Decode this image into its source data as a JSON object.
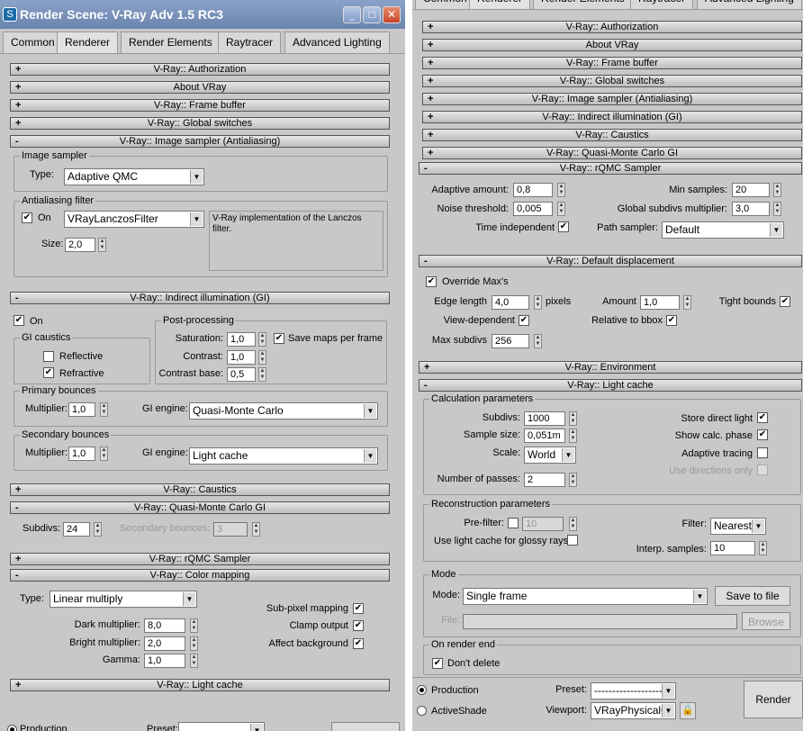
{
  "left": {
    "window_title": "Render Scene: V-Ray Adv 1.5 RC3",
    "tabs": [
      "Common",
      "Renderer",
      "Render Elements",
      "Raytracer",
      "Advanced Lighting"
    ],
    "rollouts": {
      "auth": "V-Ray:: Authorization",
      "about": "About VRay",
      "fb": "V-Ray:: Frame buffer",
      "gs": "V-Ray:: Global switches",
      "is": "V-Ray:: Image sampler (Antialiasing)",
      "gi": "V-Ray:: Indirect illumination (GI)",
      "caustics": "V-Ray:: Caustics",
      "qmc": "V-Ray:: Quasi-Monte Carlo GI",
      "rqmc": "V-Ray:: rQMC Sampler",
      "cm": "V-Ray:: Color mapping",
      "lc": "V-Ray:: Light cache"
    },
    "image_sampler": {
      "group": "Image sampler",
      "type_label": "Type:",
      "type_value": "Adaptive QMC",
      "aa_group": "Antialiasing filter",
      "on_label": "On",
      "filter_value": "VRayLanczosFilter",
      "size_label": "Size:",
      "size_value": "2,0",
      "description": "V-Ray implementation of the Lanczos filter."
    },
    "gi": {
      "on_label": "On",
      "caustics_group": "GI caustics",
      "reflective": "Reflective",
      "refractive": "Refractive",
      "post_group": "Post-processing",
      "saturation_label": "Saturation:",
      "saturation_value": "1,0",
      "save_maps": "Save maps per frame",
      "contrast_label": "Contrast:",
      "contrast_value": "1,0",
      "contrast_base_label": "Contrast base:",
      "contrast_base_value": "0,5",
      "primary_group": "Primary bounces",
      "multiplier_label": "Multiplier:",
      "primary_mult": "1,0",
      "gi_engine_label": "GI engine:",
      "primary_engine": "Quasi-Monte Carlo",
      "secondary_group": "Secondary bounces",
      "secondary_mult": "1,0",
      "secondary_engine": "Light cache"
    },
    "qmc": {
      "subdivs_label": "Subdivs:",
      "subdivs_value": "24",
      "secondary_label": "Secondary bounces:",
      "secondary_value": "3"
    },
    "cm": {
      "type_label": "Type:",
      "type_value": "Linear multiply",
      "dark_label": "Dark multiplier:",
      "dark_value": "8,0",
      "bright_label": "Bright multiplier:",
      "bright_value": "2,0",
      "gamma_label": "Gamma:",
      "gamma_value": "1,0",
      "subpixel": "Sub-pixel mapping",
      "clamp": "Clamp output",
      "affect_bg": "Affect background"
    },
    "bottom": {
      "production": "Production",
      "preset": "Preset:"
    }
  },
  "right": {
    "tabs": [
      "Common",
      "Renderer",
      "Render Elements",
      "Raytracer",
      "Advanced Lighting"
    ],
    "rollouts": {
      "auth": "V-Ray:: Authorization",
      "about": "About VRay",
      "fb": "V-Ray:: Frame buffer",
      "gs": "V-Ray:: Global switches",
      "is": "V-Ray:: Image sampler (Antialiasing)",
      "gi": "V-Ray:: Indirect illumination (GI)",
      "caustics": "V-Ray:: Caustics",
      "qmc": "V-Ray:: Quasi-Monte Carlo GI",
      "rqmc": "V-Ray:: rQMC Sampler",
      "disp": "V-Ray:: Default displacement",
      "env": "V-Ray:: Environment",
      "lc": "V-Ray:: Light cache"
    },
    "rqmc": {
      "adaptive_label": "Adaptive amount:",
      "adaptive_value": "0,8",
      "min_samples_label": "Min samples:",
      "min_samples_value": "20",
      "noise_label": "Noise threshold:",
      "noise_value": "0,005",
      "global_subdivs_label": "Global subdivs multiplier:",
      "global_subdivs_value": "3,0",
      "time_independent": "Time independent",
      "path_sampler_label": "Path sampler:",
      "path_sampler_value": "Default"
    },
    "disp": {
      "override": "Override Max's",
      "edge_label": "Edge length",
      "edge_value": "4,0",
      "pixels": "pixels",
      "amount_label": "Amount",
      "amount_value": "1,0",
      "tight_bounds": "Tight bounds",
      "view_dependent": "View-dependent",
      "relative_bbox": "Relative to bbox",
      "max_subdivs_label": "Max subdivs",
      "max_subdivs_value": "256"
    },
    "lc": {
      "calc_group": "Calculation parameters",
      "subdivs_label": "Subdivs:",
      "subdivs_value": "1000",
      "sample_size_label": "Sample size:",
      "sample_size_value": "0,051m",
      "scale_label": "Scale:",
      "scale_value": "World",
      "passes_label": "Number of passes:",
      "passes_value": "2",
      "store_direct": "Store direct light",
      "show_calc": "Show calc. phase",
      "adaptive_tracing": "Adaptive tracing",
      "use_directions": "Use directions only",
      "recon_group": "Reconstruction parameters",
      "prefilter_label": "Pre-filter:",
      "prefilter_value": "10",
      "glossy": "Use light cache for glossy rays",
      "filter_label": "Filter:",
      "filter_value": "Nearest",
      "interp_label": "Interp. samples:",
      "interp_value": "10",
      "mode_group": "Mode",
      "mode_label": "Mode:",
      "mode_value": "Single frame",
      "save_to_file": "Save to file",
      "file_label": "File:",
      "browse": "Browse",
      "on_end_group": "On render end",
      "dont_delete": "Don't delete"
    },
    "bottom": {
      "production": "Production",
      "activeshade": "ActiveShade",
      "preset_label": "Preset:",
      "preset_value": "-------------------",
      "viewport_label": "Viewport:",
      "viewport_value": "VRayPhysicalC...",
      "render": "Render"
    }
  },
  "colors": {
    "window_bg": "#c8c8c8",
    "title_gradient": "#6b84ad",
    "close_button": "#c8452a"
  }
}
